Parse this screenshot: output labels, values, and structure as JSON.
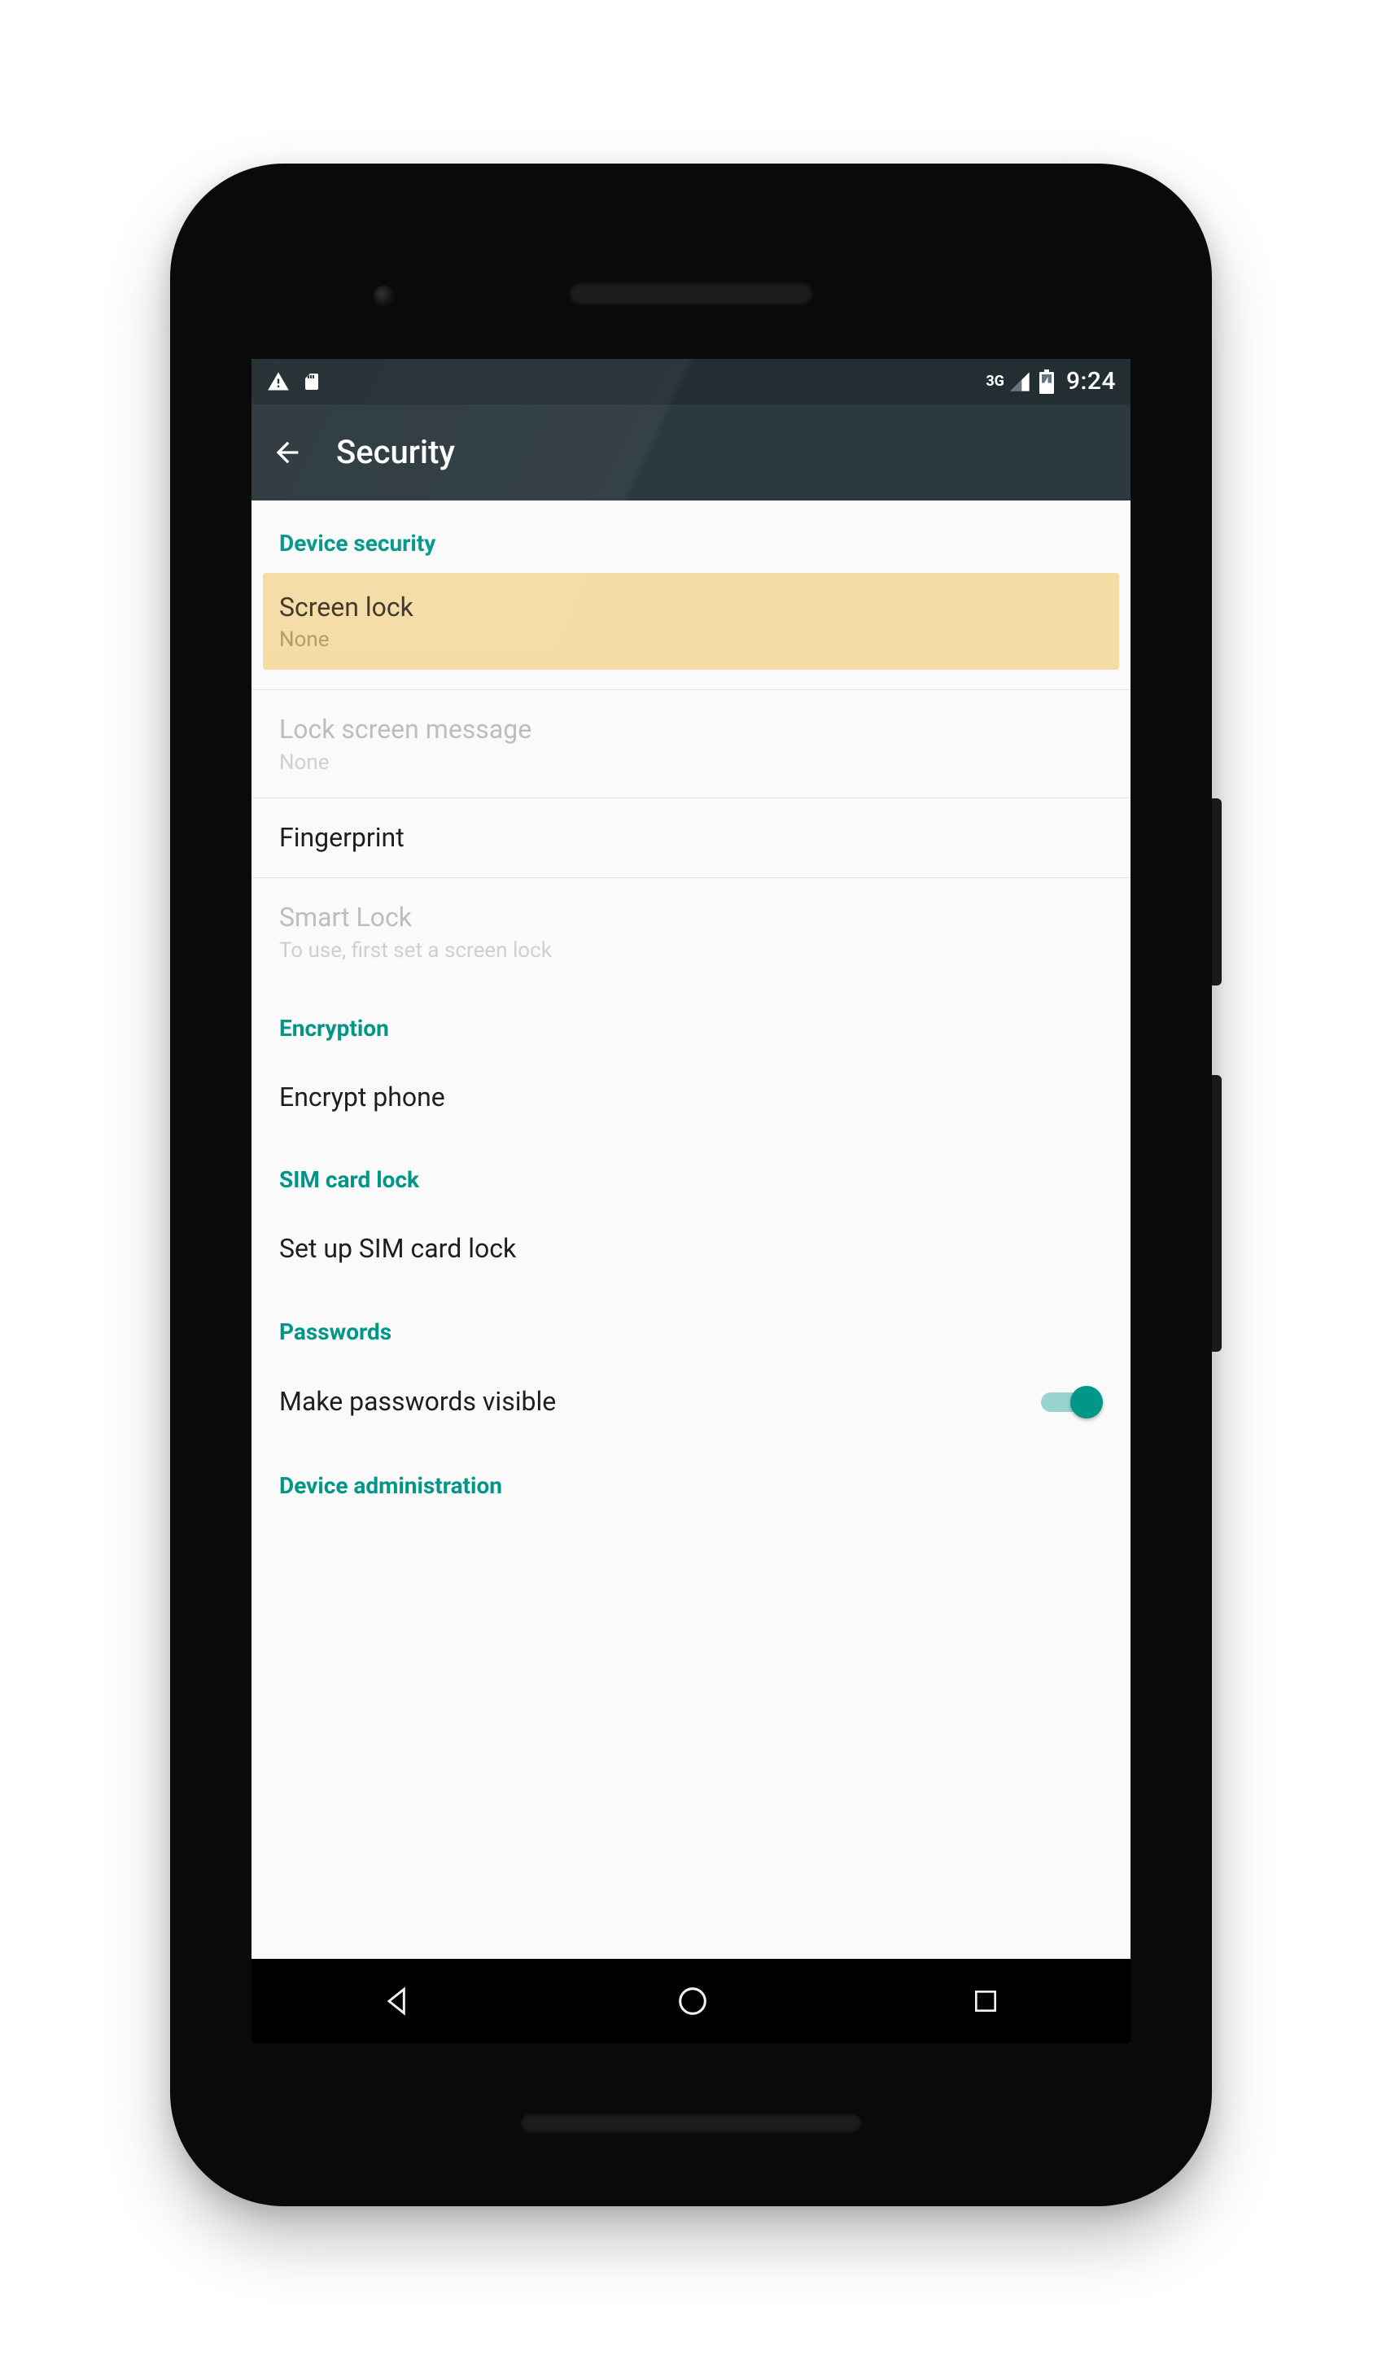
{
  "status_bar": {
    "network_label": "3G",
    "clock": "9:24"
  },
  "app_bar": {
    "title": "Security"
  },
  "sections": {
    "device_security": {
      "header": "Device security",
      "screen_lock": {
        "title": "Screen lock",
        "value": "None"
      },
      "lock_screen_message": {
        "title": "Lock screen message",
        "value": "None"
      },
      "fingerprint": {
        "title": "Fingerprint"
      },
      "smart_lock": {
        "title": "Smart Lock",
        "value": "To use, first set a screen lock"
      }
    },
    "encryption": {
      "header": "Encryption",
      "encrypt_phone": {
        "title": "Encrypt phone"
      }
    },
    "sim": {
      "header": "SIM card lock",
      "setup": {
        "title": "Set up SIM card lock"
      }
    },
    "passwords": {
      "header": "Passwords",
      "visible": {
        "title": "Make passwords visible",
        "enabled": true
      }
    },
    "device_admin": {
      "header": "Device administration"
    }
  }
}
